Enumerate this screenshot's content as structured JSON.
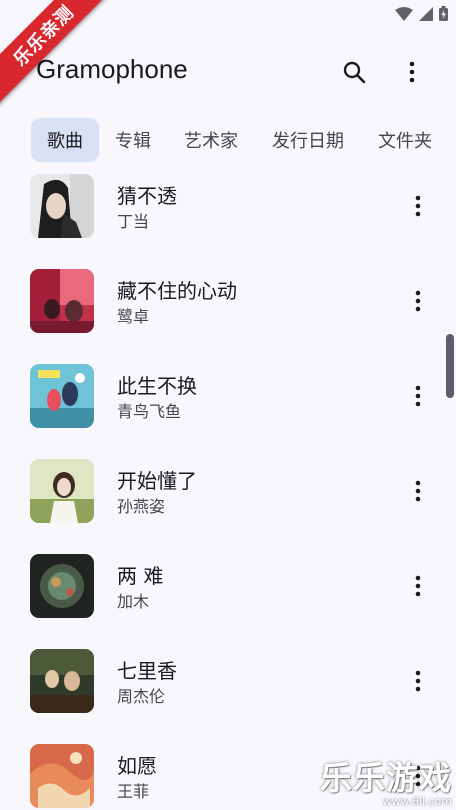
{
  "app": {
    "title": "Gramophone"
  },
  "ribbon": {
    "label": "乐乐亲测"
  },
  "tabs": [
    {
      "label": "歌曲",
      "active": true
    },
    {
      "label": "专辑",
      "active": false
    },
    {
      "label": "艺术家",
      "active": false
    },
    {
      "label": "发行日期",
      "active": false
    },
    {
      "label": "文件夹",
      "active": false
    }
  ],
  "songs": [
    {
      "title": "猜不透",
      "artist": "丁当"
    },
    {
      "title": "藏不住的心动",
      "artist": "鹭卓"
    },
    {
      "title": "此生不换",
      "artist": "青鸟飞鱼"
    },
    {
      "title": "开始懂了",
      "artist": "孙燕姿"
    },
    {
      "title": "两 难",
      "artist": "加木"
    },
    {
      "title": "七里香",
      "artist": "周杰伦"
    },
    {
      "title": "如愿",
      "artist": "王菲"
    }
  ],
  "watermark": {
    "main": "乐乐游戏",
    "sub": "www.6ll.com"
  },
  "colors": {
    "accent_tab": "#d9e2f5",
    "background": "#f7f7fc",
    "ribbon": "#d9272e"
  }
}
